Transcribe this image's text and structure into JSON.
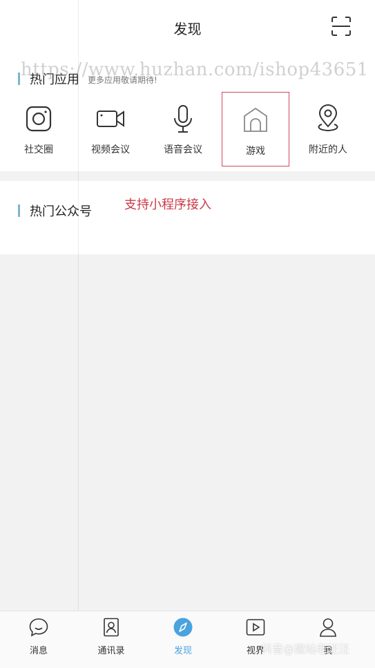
{
  "header": {
    "title": "发现",
    "scan_icon": "scan-icon"
  },
  "watermark": "https://www.huzhan.com/ishop43651",
  "hot_apps": {
    "title": "热门应用",
    "subtitle": "更多应用敬请期待!",
    "items": [
      {
        "label": "社交圈",
        "icon": "camera-icon"
      },
      {
        "label": "视频会议",
        "icon": "video-camera-icon"
      },
      {
        "label": "语音会议",
        "icon": "microphone-icon"
      },
      {
        "label": "游戏",
        "icon": "house-icon",
        "selected": true
      },
      {
        "label": "附近的人",
        "icon": "location-pin-icon"
      }
    ]
  },
  "hot_accounts": {
    "title": "热门公众号"
  },
  "annotation": "支持小程序接入",
  "colors": {
    "accent_bar": "#7cb5cf",
    "active_tab": "#4aa3df",
    "annotation": "#c93a48"
  },
  "bottom_nav": {
    "items": [
      {
        "label": "消息",
        "icon": "chat-bubble-icon"
      },
      {
        "label": "通讯录",
        "icon": "contact-card-icon"
      },
      {
        "label": "发现",
        "icon": "compass-icon",
        "active": true
      },
      {
        "label": "视界",
        "icon": "play-video-icon"
      },
      {
        "label": "我",
        "icon": "person-icon"
      }
    ]
  },
  "corner_watermark": "抖音@建站老汪汪"
}
